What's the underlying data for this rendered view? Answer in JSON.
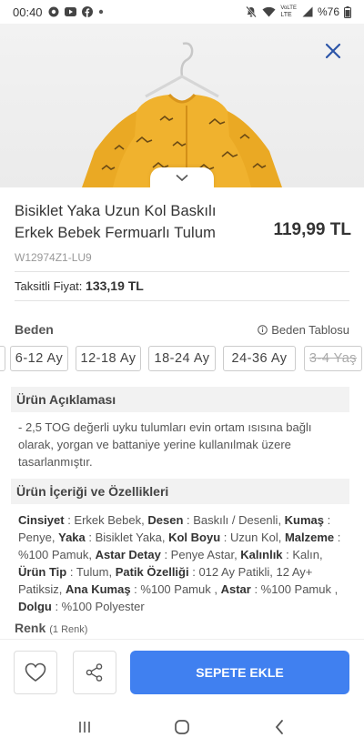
{
  "status": {
    "time": "00:40",
    "battery": "%76",
    "lte": "LTE",
    "volte": "VoLTE"
  },
  "product": {
    "title": "Bisiklet Yaka Uzun Kol Baskılı Erkek Bebek Fermuarlı Tulum",
    "price": "119,99 TL",
    "sku": "W12974Z1-LU9",
    "installment_label": "Taksitli Fiyat:",
    "installment_price": "133,19 TL"
  },
  "size_section": {
    "label": "Beden",
    "table_link": "Beden Tablosu",
    "sizes": [
      {
        "label": "",
        "available": true
      },
      {
        "label": "6-12 Ay",
        "available": true
      },
      {
        "label": "12-18 Ay",
        "available": true
      },
      {
        "label": "18-24 Ay",
        "available": true
      },
      {
        "label": "24-36 Ay",
        "available": true
      },
      {
        "label": "3-4 Yaş",
        "available": false
      }
    ]
  },
  "description": {
    "title": "Ürün Açıklaması",
    "text": "- 2,5 TOG değerli uyku tulumları evin ortam ısısına bağlı olarak, yorgan ve battaniye yerine kullanılmak üzere tasarlanmıştır."
  },
  "features": {
    "title": "Ürün İçeriği ve Özellikleri",
    "items": [
      {
        "key": "Cinsiyet",
        "value": "Erkek Bebek"
      },
      {
        "key": "Desen",
        "value": "Baskılı / Desenli"
      },
      {
        "key": "Kumaş",
        "value": "Penye"
      },
      {
        "key": "Yaka",
        "value": "Bisiklet Yaka"
      },
      {
        "key": "Kol Boyu",
        "value": "Uzun Kol"
      },
      {
        "key": "Malzeme",
        "value": "%100 Pamuk"
      },
      {
        "key": "Astar Detay",
        "value": "Penye Astar"
      },
      {
        "key": "Kalınlık",
        "value": "Kalın"
      },
      {
        "key": "Ürün Tip",
        "value": "Tulum"
      },
      {
        "key": "Patik Özelliği",
        "value": "012 Ay Patikli, 12 Ay+ Patiksiz"
      },
      {
        "key": "Ana Kumaş",
        "value": "%100 Pamuk "
      },
      {
        "key": "Astar",
        "value": "%100 Pamuk "
      },
      {
        "key": "Dolgu",
        "value": "%100 Polyester"
      }
    ]
  },
  "color": {
    "label": "Renk",
    "count": "(1 Renk)"
  },
  "actions": {
    "add_to_cart": "SEPETE EKLE",
    "favorite_icon": "heart-icon",
    "share_icon": "share-icon"
  },
  "colors": {
    "accent": "#4080f0",
    "close": "#2c55a8",
    "garment": "#f0b22e"
  }
}
